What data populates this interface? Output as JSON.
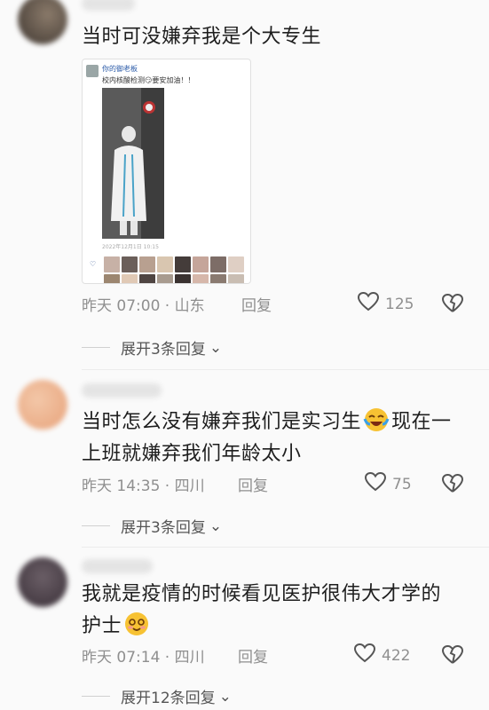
{
  "comments": [
    {
      "text": "当时可没嫌弃我是个大专生",
      "meta": "昨天 07:00 · 山东",
      "reply_label": "回复",
      "likes": "125",
      "expand": "展开3条回复",
      "screenshot": {
        "user": "你的御老板",
        "post": "校内核酸检测😏要安加油！！",
        "time": "2022年12月1日 10:15"
      }
    },
    {
      "text_line1": "当时怎么没有嫌弃我们是实习生",
      "text_line1b": "现在一",
      "text_line2": "上班就嫌弃我们年龄太小",
      "emoji": "laughing-crying-emoji",
      "meta": "昨天 14:35 · 四川",
      "reply_label": "回复",
      "likes": "75",
      "expand": "展开3条回复"
    },
    {
      "text_line1": "我就是疫情的时候看见医护很伟大才学的",
      "text_line2": "护士",
      "emoji": "smiling-emoji",
      "meta": "昨天 07:14 · 四川",
      "reply_label": "回复",
      "likes": "422",
      "expand": "展开12条回复"
    }
  ],
  "colors": {
    "text": "#1e1e1e",
    "meta": "#8f8f8f",
    "background": "#fafafa"
  }
}
